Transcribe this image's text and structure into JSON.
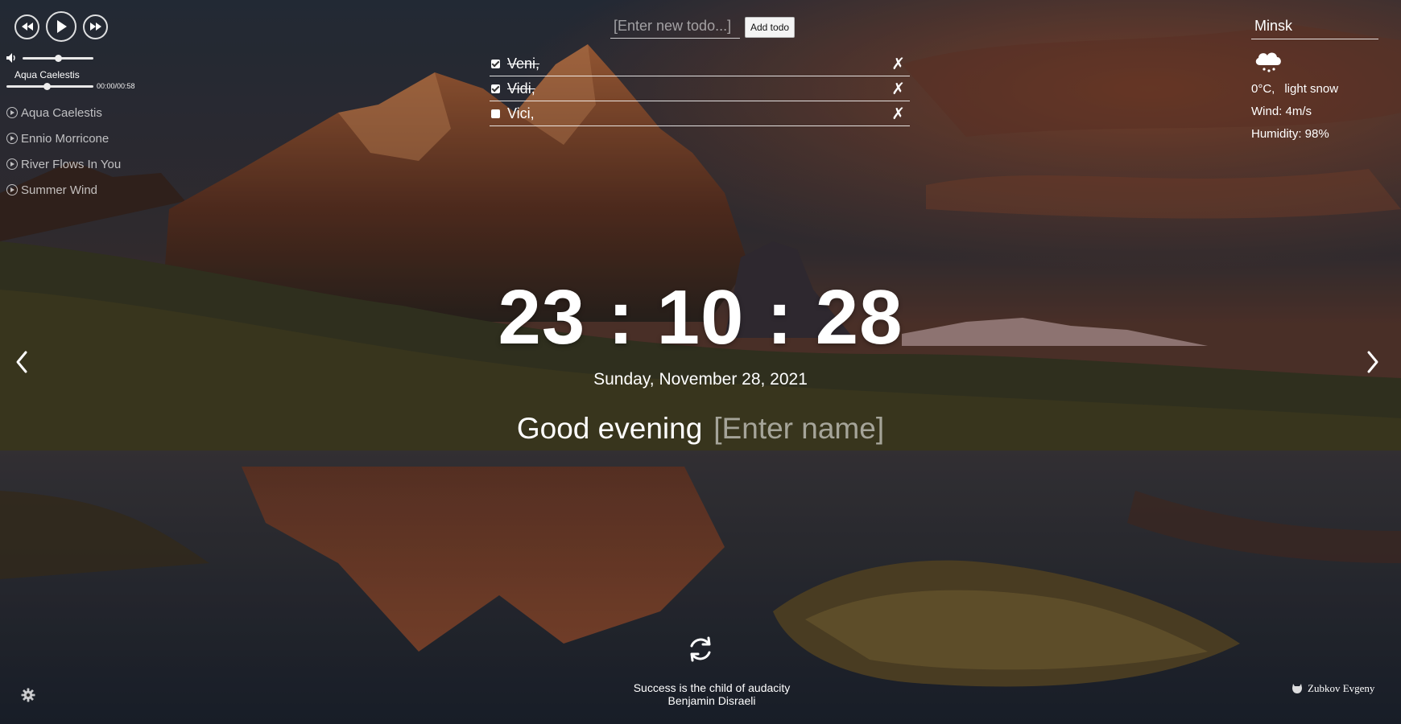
{
  "player": {
    "current_track": "Aqua Caelestis",
    "time": "00:00/00:58",
    "volume": 0.5,
    "progress": 0.46,
    "playlist": [
      "Aqua Caelestis",
      "Ennio Morricone",
      "River Flows In You",
      "Summer Wind"
    ]
  },
  "todo": {
    "placeholder": "[Enter new todo...]",
    "add_label": "Add todo",
    "items": [
      {
        "text": "Veni,",
        "done": true
      },
      {
        "text": "Vidi,",
        "done": true
      },
      {
        "text": "Vici,",
        "done": false
      }
    ],
    "delete_glyph": "✗"
  },
  "weather": {
    "city": "Minsk",
    "temperature": "0°C,",
    "description": "light snow",
    "wind": "Wind: 4m/s",
    "humidity": "Humidity: 98%",
    "icon": "snow-cloud-icon"
  },
  "clock": {
    "time": "23 : 10 : 28"
  },
  "date": "Sunday, November 28, 2021",
  "greeting": {
    "text": "Good evening",
    "name_placeholder": "[Enter name]"
  },
  "quote": {
    "text": "Success is the child of audacity",
    "author": "Benjamin Disraeli"
  },
  "footer": {
    "author": "Zubkov Evgeny"
  },
  "colors": {
    "background": "#1e2026",
    "text": "#ffffff",
    "sunset_accent": "#c8643a"
  }
}
